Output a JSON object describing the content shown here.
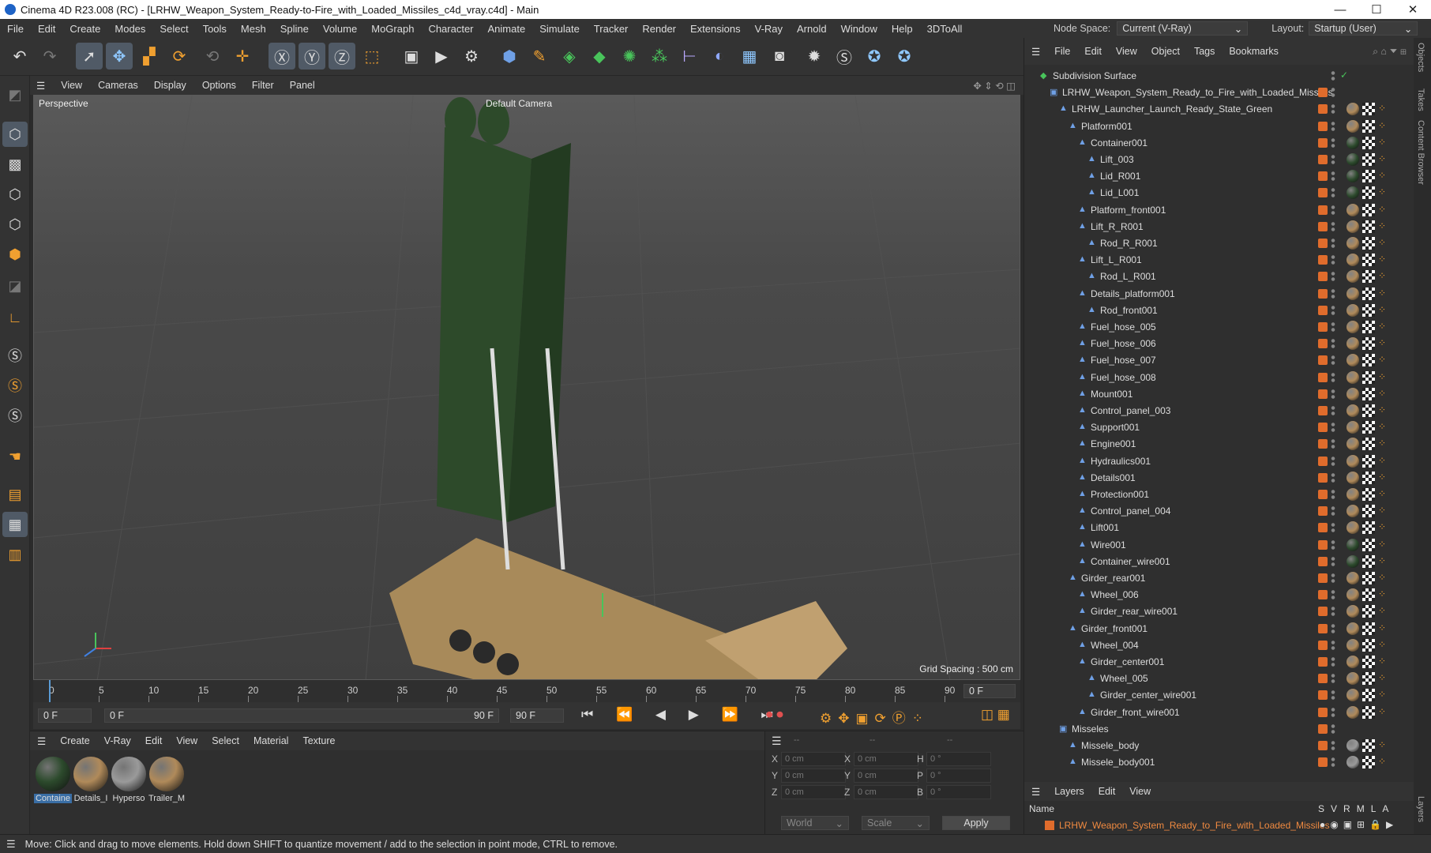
{
  "window": {
    "title": "Cinema 4D R23.008 (RC) - [LRHW_Weapon_System_Ready-to-Fire_with_Loaded_Missiles_c4d_vray.c4d] - Main",
    "min": "—",
    "max": "☐",
    "close": "✕"
  },
  "menubar": [
    "File",
    "Edit",
    "Create",
    "Modes",
    "Select",
    "Tools",
    "Mesh",
    "Spline",
    "Volume",
    "MoGraph",
    "Character",
    "Animate",
    "Simulate",
    "Tracker",
    "Render",
    "Extensions",
    "V-Ray",
    "Arnold",
    "Window",
    "Help",
    "3DToAll"
  ],
  "nodespace": {
    "label": "Node Space:",
    "value": "Current (V-Ray)",
    "layout_label": "Layout:",
    "layout_value": "Startup (User)"
  },
  "viewport": {
    "menu": [
      "View",
      "Cameras",
      "Display",
      "Options",
      "Filter",
      "Panel"
    ],
    "label": "Perspective",
    "camera": "Default Camera",
    "grid": "Grid Spacing : 500 cm"
  },
  "timeline": {
    "ticks": [
      "0",
      "5",
      "10",
      "15",
      "20",
      "25",
      "30",
      "35",
      "40",
      "45",
      "50",
      "55",
      "60",
      "65",
      "70",
      "75",
      "80",
      "85",
      "90"
    ],
    "current": "0 F",
    "start": "0 F",
    "range_start": "0 F",
    "range_end": "90 F",
    "end": "90 F"
  },
  "material": {
    "menu": [
      "Create",
      "V-Ray",
      "Edit",
      "View",
      "Select",
      "Material",
      "Texture"
    ],
    "items": [
      {
        "name": "Containe",
        "color": "#2c4a2c"
      },
      {
        "name": "Details_I",
        "color": "#b08a5a"
      },
      {
        "name": "Hyperso",
        "color": "#9a9a9a"
      },
      {
        "name": "Trailer_M",
        "color": "#b08a5a"
      }
    ]
  },
  "coords": {
    "rows": [
      {
        "a": "X",
        "av": "0 cm",
        "b": "X",
        "bv": "0 cm",
        "c": "H",
        "cv": "0 °"
      },
      {
        "a": "Y",
        "av": "0 cm",
        "b": "Y",
        "bv": "0 cm",
        "c": "P",
        "cv": "0 °"
      },
      {
        "a": "Z",
        "av": "0 cm",
        "b": "Z",
        "bv": "0 cm",
        "c": "B",
        "cv": "0 °"
      }
    ],
    "top": [
      "--",
      "--",
      "--"
    ],
    "space": "World",
    "mode": "Scale",
    "apply": "Apply"
  },
  "objects": {
    "menu": [
      "File",
      "Edit",
      "View",
      "Object",
      "Tags",
      "Bookmarks"
    ],
    "items": [
      {
        "name": "Subdivision Surface",
        "depth": 0,
        "mat": "none",
        "color": "#49c45b"
      },
      {
        "name": "LRHW_Weapon_System_Ready_to_Fire_with_Loaded_Missiles",
        "depth": 1,
        "mat": "none"
      },
      {
        "name": "LRHW_Launcher_Launch_Ready_State_Green",
        "depth": 2,
        "mat": "tan"
      },
      {
        "name": "Platform001",
        "depth": 3,
        "mat": "tan"
      },
      {
        "name": "Container001",
        "depth": 4,
        "mat": "green"
      },
      {
        "name": "Lift_003",
        "depth": 5,
        "mat": "green"
      },
      {
        "name": "Lid_R001",
        "depth": 5,
        "mat": "green"
      },
      {
        "name": "Lid_L001",
        "depth": 5,
        "mat": "green"
      },
      {
        "name": "Platform_front001",
        "depth": 4,
        "mat": "tan"
      },
      {
        "name": "Lift_R_R001",
        "depth": 4,
        "mat": "tan"
      },
      {
        "name": "Rod_R_R001",
        "depth": 5,
        "mat": "tan"
      },
      {
        "name": "Lift_L_R001",
        "depth": 4,
        "mat": "tan"
      },
      {
        "name": "Rod_L_R001",
        "depth": 5,
        "mat": "tan"
      },
      {
        "name": "Details_platform001",
        "depth": 4,
        "mat": "tan"
      },
      {
        "name": "Rod_front001",
        "depth": 5,
        "mat": "tan"
      },
      {
        "name": "Fuel_hose_005",
        "depth": 4,
        "mat": "tan"
      },
      {
        "name": "Fuel_hose_006",
        "depth": 4,
        "mat": "tan"
      },
      {
        "name": "Fuel_hose_007",
        "depth": 4,
        "mat": "tan"
      },
      {
        "name": "Fuel_hose_008",
        "depth": 4,
        "mat": "tan"
      },
      {
        "name": "Mount001",
        "depth": 4,
        "mat": "tan"
      },
      {
        "name": "Control_panel_003",
        "depth": 4,
        "mat": "tan"
      },
      {
        "name": "Support001",
        "depth": 4,
        "mat": "tan"
      },
      {
        "name": "Engine001",
        "depth": 4,
        "mat": "tan"
      },
      {
        "name": "Hydraulics001",
        "depth": 4,
        "mat": "tan"
      },
      {
        "name": "Details001",
        "depth": 4,
        "mat": "tan"
      },
      {
        "name": "Protection001",
        "depth": 4,
        "mat": "tan"
      },
      {
        "name": "Control_panel_004",
        "depth": 4,
        "mat": "tan"
      },
      {
        "name": "Lift001",
        "depth": 4,
        "mat": "tan"
      },
      {
        "name": "Wire001",
        "depth": 4,
        "mat": "green"
      },
      {
        "name": "Container_wire001",
        "depth": 4,
        "mat": "green"
      },
      {
        "name": "Girder_rear001",
        "depth": 3,
        "mat": "tan"
      },
      {
        "name": "Wheel_006",
        "depth": 4,
        "mat": "tan"
      },
      {
        "name": "Girder_rear_wire001",
        "depth": 4,
        "mat": "tan"
      },
      {
        "name": "Girder_front001",
        "depth": 3,
        "mat": "tan"
      },
      {
        "name": "Wheel_004",
        "depth": 4,
        "mat": "tan"
      },
      {
        "name": "Girder_center001",
        "depth": 4,
        "mat": "tan"
      },
      {
        "name": "Wheel_005",
        "depth": 5,
        "mat": "tan"
      },
      {
        "name": "Girder_center_wire001",
        "depth": 5,
        "mat": "tan"
      },
      {
        "name": "Girder_front_wire001",
        "depth": 4,
        "mat": "tan"
      },
      {
        "name": "Misseles",
        "depth": 2,
        "mat": "none"
      },
      {
        "name": "Missele_body",
        "depth": 3,
        "mat": "grey"
      },
      {
        "name": "Missele_body001",
        "depth": 3,
        "mat": "grey"
      }
    ]
  },
  "layers": {
    "menu": [
      "Layers",
      "Edit",
      "View"
    ],
    "head": "Name",
    "cols": [
      "S",
      "V",
      "R",
      "M",
      "L",
      "A"
    ],
    "row": "LRHW_Weapon_System_Ready_to_Fire_with_Loaded_Missiles"
  },
  "rail": [
    "Objects",
    "Takes",
    "Content Browser",
    "Layers"
  ],
  "status": "Move: Click and drag to move elements. Hold down SHIFT to quantize movement / add to the selection in point mode, CTRL to remove.",
  "colors": {
    "accent": "#e06c2c",
    "tan": "#b08a5a",
    "green": "#2c4a2c"
  }
}
